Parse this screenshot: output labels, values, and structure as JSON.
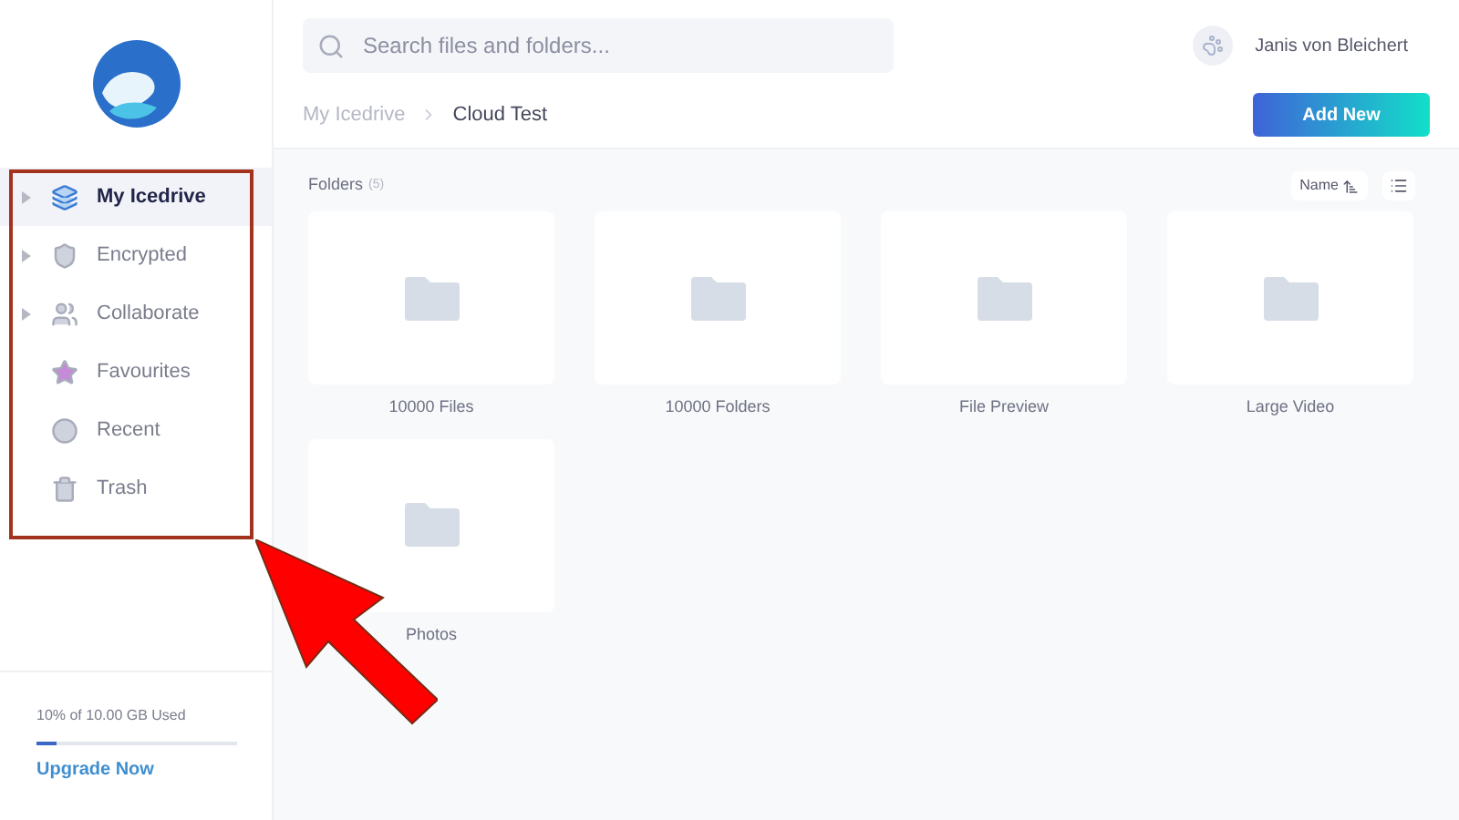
{
  "sidebar": {
    "items": [
      {
        "label": "My Icedrive",
        "expandable": true,
        "selected": true
      },
      {
        "label": "Encrypted",
        "expandable": true,
        "selected": false
      },
      {
        "label": "Collaborate",
        "expandable": true,
        "selected": false
      },
      {
        "label": "Favourites",
        "expandable": false,
        "selected": false
      },
      {
        "label": "Recent",
        "expandable": false,
        "selected": false
      },
      {
        "label": "Trash",
        "expandable": false,
        "selected": false
      }
    ],
    "storage": {
      "text": "10% of 10.00 GB Used",
      "level": 0.1,
      "link": "Upgrade Now"
    }
  },
  "search": {
    "placeholder": "Search files and folders..."
  },
  "user": {
    "name": "Janis von Bleichert"
  },
  "breadcrumb": [
    "My Icedrive",
    "Cloud Test"
  ],
  "add_button": "Add New",
  "folders_header": {
    "title": "Folders",
    "count": "(5)",
    "sort": "Name"
  },
  "folders": [
    {
      "name": "10000 Files"
    },
    {
      "name": "10000 Folders"
    },
    {
      "name": "File Preview"
    },
    {
      "name": "Large Video"
    },
    {
      "name": "Photos"
    }
  ]
}
